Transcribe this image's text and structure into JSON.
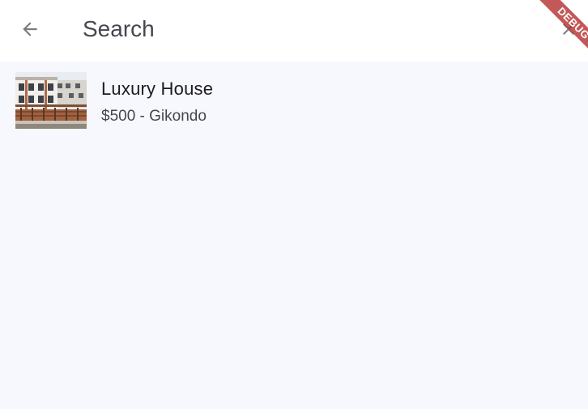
{
  "app_bar": {
    "back_icon": "arrow-back-icon",
    "search_placeholder": "Search",
    "search_value": "",
    "clear_icon": "close-icon"
  },
  "results": [
    {
      "title": "Luxury House",
      "subtitle": "$500 - Gikondo",
      "thumbnail": "house-photo"
    }
  ],
  "debug_banner": {
    "label": "DEBUG",
    "color": "#b42828"
  },
  "colors": {
    "app_bar": "#ffffff",
    "background": "#f7f8fd",
    "icon": "#7a7a80",
    "title_text": "#1c1b1f",
    "subtitle_text": "#46464f"
  }
}
